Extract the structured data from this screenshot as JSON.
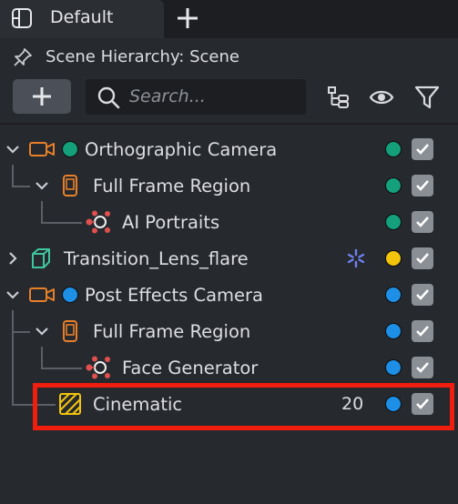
{
  "tabs": [
    {
      "label": "Default",
      "active": true
    }
  ],
  "panel": {
    "title": "Scene Hierarchy: Scene"
  },
  "toolbar": {
    "search_placeholder": "Search...",
    "search_value": ""
  },
  "colors": {
    "green": "#14a07a",
    "blue": "#1d8fe6",
    "yellow": "#f2c40c",
    "orange": "#e8802a",
    "checkbox": "#8a8e95",
    "highlight": "#f01e0e"
  },
  "rows": [
    {
      "label": "Orthographic Camera",
      "icon": "camera-icon",
      "expanded": true,
      "type_dot": "green",
      "visibility": "green",
      "checked": true
    },
    {
      "label": "Full Frame Region",
      "icon": "frame-region-icon",
      "expanded": true,
      "visibility": "green",
      "checked": true
    },
    {
      "label": "AI Portraits",
      "icon": "ml-component-icon",
      "visibility": "green",
      "checked": true
    },
    {
      "label": "Transition_Lens_flare",
      "icon": "prefab-cube-icon",
      "expanded": false,
      "badge_icon": "sparkle-icon",
      "visibility": "yellow",
      "checked": true
    },
    {
      "label": "Post Effects Camera",
      "icon": "camera-icon",
      "expanded": true,
      "type_dot": "blue",
      "visibility": "blue",
      "checked": true
    },
    {
      "label": "Full Frame Region",
      "icon": "frame-region-icon",
      "expanded": true,
      "visibility": "blue",
      "checked": true
    },
    {
      "label": "Face Generator",
      "icon": "ml-component-icon",
      "visibility": "blue",
      "checked": true
    },
    {
      "label": "Cinematic",
      "icon": "post-effect-icon",
      "layer": "20",
      "visibility": "blue",
      "checked": true,
      "highlighted": true
    }
  ]
}
